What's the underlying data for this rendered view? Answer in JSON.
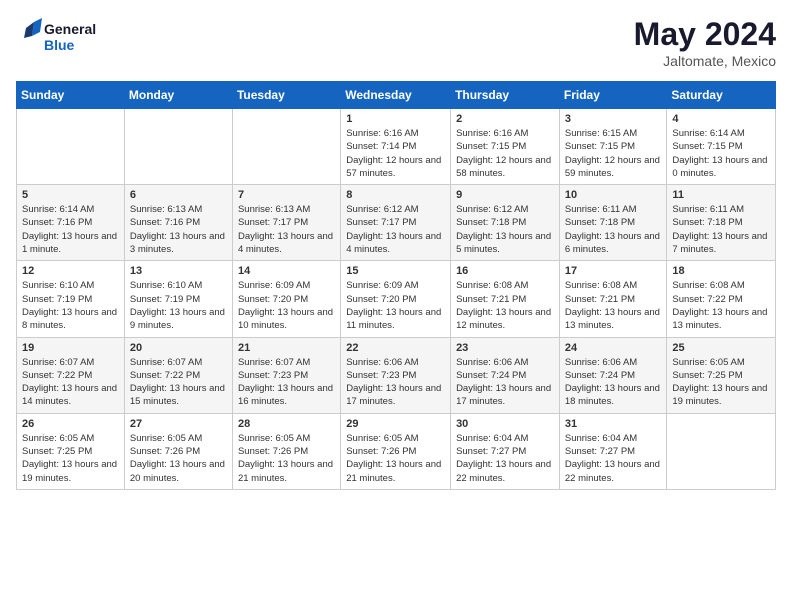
{
  "logo": {
    "line1": "General",
    "line2": "Blue"
  },
  "title": "May 2024",
  "subtitle": "Jaltomate, Mexico",
  "days_header": [
    "Sunday",
    "Monday",
    "Tuesday",
    "Wednesday",
    "Thursday",
    "Friday",
    "Saturday"
  ],
  "weeks": [
    [
      {
        "day": "",
        "info": ""
      },
      {
        "day": "",
        "info": ""
      },
      {
        "day": "",
        "info": ""
      },
      {
        "day": "1",
        "info": "Sunrise: 6:16 AM\nSunset: 7:14 PM\nDaylight: 12 hours and 57 minutes."
      },
      {
        "day": "2",
        "info": "Sunrise: 6:16 AM\nSunset: 7:15 PM\nDaylight: 12 hours and 58 minutes."
      },
      {
        "day": "3",
        "info": "Sunrise: 6:15 AM\nSunset: 7:15 PM\nDaylight: 12 hours and 59 minutes."
      },
      {
        "day": "4",
        "info": "Sunrise: 6:14 AM\nSunset: 7:15 PM\nDaylight: 13 hours and 0 minutes."
      }
    ],
    [
      {
        "day": "5",
        "info": "Sunrise: 6:14 AM\nSunset: 7:16 PM\nDaylight: 13 hours and 1 minute."
      },
      {
        "day": "6",
        "info": "Sunrise: 6:13 AM\nSunset: 7:16 PM\nDaylight: 13 hours and 3 minutes."
      },
      {
        "day": "7",
        "info": "Sunrise: 6:13 AM\nSunset: 7:17 PM\nDaylight: 13 hours and 4 minutes."
      },
      {
        "day": "8",
        "info": "Sunrise: 6:12 AM\nSunset: 7:17 PM\nDaylight: 13 hours and 4 minutes."
      },
      {
        "day": "9",
        "info": "Sunrise: 6:12 AM\nSunset: 7:18 PM\nDaylight: 13 hours and 5 minutes."
      },
      {
        "day": "10",
        "info": "Sunrise: 6:11 AM\nSunset: 7:18 PM\nDaylight: 13 hours and 6 minutes."
      },
      {
        "day": "11",
        "info": "Sunrise: 6:11 AM\nSunset: 7:18 PM\nDaylight: 13 hours and 7 minutes."
      }
    ],
    [
      {
        "day": "12",
        "info": "Sunrise: 6:10 AM\nSunset: 7:19 PM\nDaylight: 13 hours and 8 minutes."
      },
      {
        "day": "13",
        "info": "Sunrise: 6:10 AM\nSunset: 7:19 PM\nDaylight: 13 hours and 9 minutes."
      },
      {
        "day": "14",
        "info": "Sunrise: 6:09 AM\nSunset: 7:20 PM\nDaylight: 13 hours and 10 minutes."
      },
      {
        "day": "15",
        "info": "Sunrise: 6:09 AM\nSunset: 7:20 PM\nDaylight: 13 hours and 11 minutes."
      },
      {
        "day": "16",
        "info": "Sunrise: 6:08 AM\nSunset: 7:21 PM\nDaylight: 13 hours and 12 minutes."
      },
      {
        "day": "17",
        "info": "Sunrise: 6:08 AM\nSunset: 7:21 PM\nDaylight: 13 hours and 13 minutes."
      },
      {
        "day": "18",
        "info": "Sunrise: 6:08 AM\nSunset: 7:22 PM\nDaylight: 13 hours and 13 minutes."
      }
    ],
    [
      {
        "day": "19",
        "info": "Sunrise: 6:07 AM\nSunset: 7:22 PM\nDaylight: 13 hours and 14 minutes."
      },
      {
        "day": "20",
        "info": "Sunrise: 6:07 AM\nSunset: 7:22 PM\nDaylight: 13 hours and 15 minutes."
      },
      {
        "day": "21",
        "info": "Sunrise: 6:07 AM\nSunset: 7:23 PM\nDaylight: 13 hours and 16 minutes."
      },
      {
        "day": "22",
        "info": "Sunrise: 6:06 AM\nSunset: 7:23 PM\nDaylight: 13 hours and 17 minutes."
      },
      {
        "day": "23",
        "info": "Sunrise: 6:06 AM\nSunset: 7:24 PM\nDaylight: 13 hours and 17 minutes."
      },
      {
        "day": "24",
        "info": "Sunrise: 6:06 AM\nSunset: 7:24 PM\nDaylight: 13 hours and 18 minutes."
      },
      {
        "day": "25",
        "info": "Sunrise: 6:05 AM\nSunset: 7:25 PM\nDaylight: 13 hours and 19 minutes."
      }
    ],
    [
      {
        "day": "26",
        "info": "Sunrise: 6:05 AM\nSunset: 7:25 PM\nDaylight: 13 hours and 19 minutes."
      },
      {
        "day": "27",
        "info": "Sunrise: 6:05 AM\nSunset: 7:26 PM\nDaylight: 13 hours and 20 minutes."
      },
      {
        "day": "28",
        "info": "Sunrise: 6:05 AM\nSunset: 7:26 PM\nDaylight: 13 hours and 21 minutes."
      },
      {
        "day": "29",
        "info": "Sunrise: 6:05 AM\nSunset: 7:26 PM\nDaylight: 13 hours and 21 minutes."
      },
      {
        "day": "30",
        "info": "Sunrise: 6:04 AM\nSunset: 7:27 PM\nDaylight: 13 hours and 22 minutes."
      },
      {
        "day": "31",
        "info": "Sunrise: 6:04 AM\nSunset: 7:27 PM\nDaylight: 13 hours and 22 minutes."
      },
      {
        "day": "",
        "info": ""
      }
    ]
  ]
}
